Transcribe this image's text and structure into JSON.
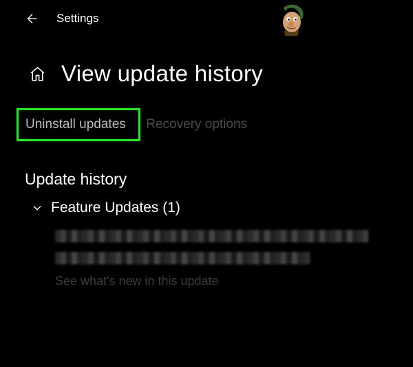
{
  "header": {
    "title": "Settings"
  },
  "page": {
    "title": "View update history"
  },
  "links": {
    "uninstall": "Uninstall updates",
    "recovery": "Recovery options"
  },
  "section": {
    "heading": "Update history"
  },
  "collapsible": {
    "label": "Feature Updates (1)"
  },
  "details": {
    "see_new": "See what's new in this update"
  }
}
